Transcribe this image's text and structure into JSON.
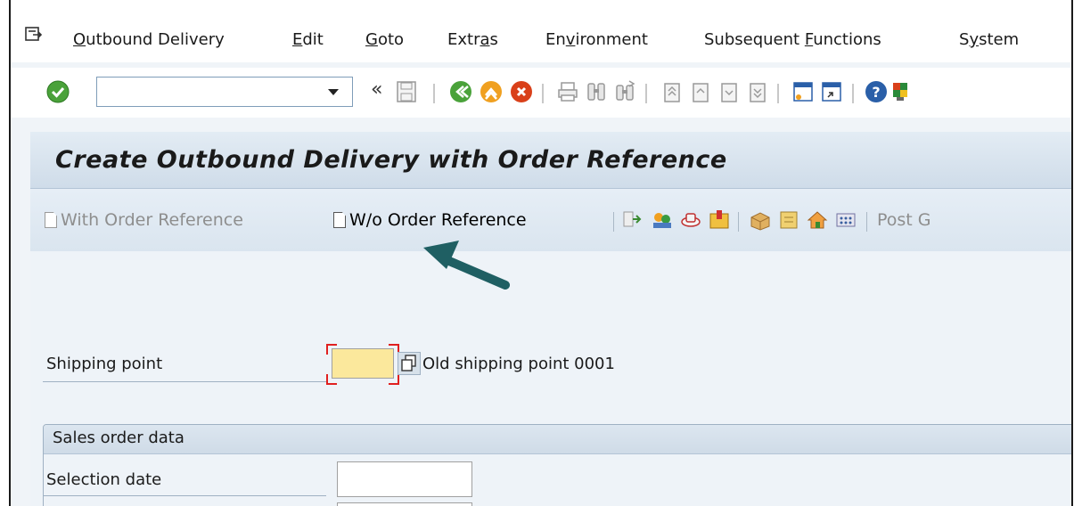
{
  "menu": {
    "items": [
      {
        "label": "Outbound Delivery",
        "u": "O",
        "rest": "utbound Delivery"
      },
      {
        "label": "Edit",
        "u": "E",
        "rest": "dit"
      },
      {
        "label": "Goto",
        "u": "G",
        "rest": "oto"
      },
      {
        "label": "Extras",
        "pre": "Extr",
        "u": "a",
        "rest": "s"
      },
      {
        "label": "Environment",
        "pre": "En",
        "u": "v",
        "rest": "ironment"
      },
      {
        "label": "Subsequent Functions",
        "pre": "Subsequent ",
        "u": "F",
        "rest": "unctions"
      },
      {
        "label": "System",
        "pre": "S",
        "u": "y",
        "rest": "stem"
      }
    ]
  },
  "toolbar": {
    "command_field_value": "",
    "back_glyph": "«"
  },
  "page": {
    "title": "Create Outbound Delivery with Order Reference"
  },
  "app_toolbar": {
    "with_order_ref": "With Order Reference",
    "wo_order_ref": "W/o Order Reference",
    "post_goods": "Post G"
  },
  "form": {
    "shipping_point_label": "Shipping point",
    "shipping_point_value": "",
    "shipping_point_desc": "Old shipping point 0001",
    "sales_order_group": "Sales order data",
    "selection_date_label": "Selection date",
    "selection_date_value": ""
  },
  "colors": {
    "title_bg": "#d7e3ee",
    "required_input": "#fbe89c",
    "arrow": "#1f5f63"
  }
}
